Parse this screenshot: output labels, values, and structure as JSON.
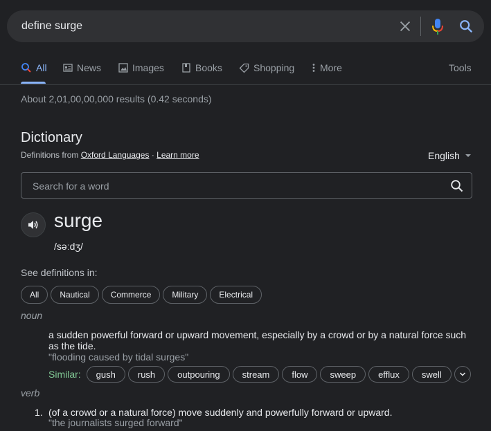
{
  "search": {
    "query": "define surge"
  },
  "tabs": [
    {
      "label": "All",
      "icon": "search-icon",
      "active": true
    },
    {
      "label": "News",
      "icon": "news-icon"
    },
    {
      "label": "Images",
      "icon": "image-icon"
    },
    {
      "label": "Books",
      "icon": "book-icon"
    },
    {
      "label": "Shopping",
      "icon": "tag-icon"
    },
    {
      "label": "More",
      "icon": "more-vert-icon"
    }
  ],
  "tools_label": "Tools",
  "result_stats": "About 2,01,00,00,000 results (0.42 seconds)",
  "dictionary": {
    "title": "Dictionary",
    "defs_from_prefix": "Definitions from",
    "source_link": "Oxford Languages",
    "separator": "·",
    "learn_more": "Learn more",
    "language": "English",
    "word_search_placeholder": "Search for a word",
    "headword": "surge",
    "phonetic": "/səːdʒ/",
    "see_definitions_label": "See definitions in:",
    "filter_chips": [
      "All",
      "Nautical",
      "Commerce",
      "Military",
      "Electrical"
    ],
    "noun": {
      "pos": "noun",
      "definition_line1": "a sudden powerful forward or upward movement, especially by a crowd or by a natural force such",
      "definition_line2": "as the tide.",
      "example": "\"flooding caused by tidal surges\"",
      "similar_label": "Similar:",
      "synonyms": [
        "gush",
        "rush",
        "outpouring",
        "stream",
        "flow",
        "sweep",
        "efflux",
        "swell"
      ]
    },
    "verb": {
      "pos": "verb",
      "number": "1.",
      "definition": "(of a crowd or a natural force) move suddenly and powerfully forward or upward.",
      "example": "\"the journalists surged forward\""
    }
  },
  "colors": {
    "background": "#202124",
    "accent": "#8ab4f8",
    "similar": "#81c995"
  }
}
